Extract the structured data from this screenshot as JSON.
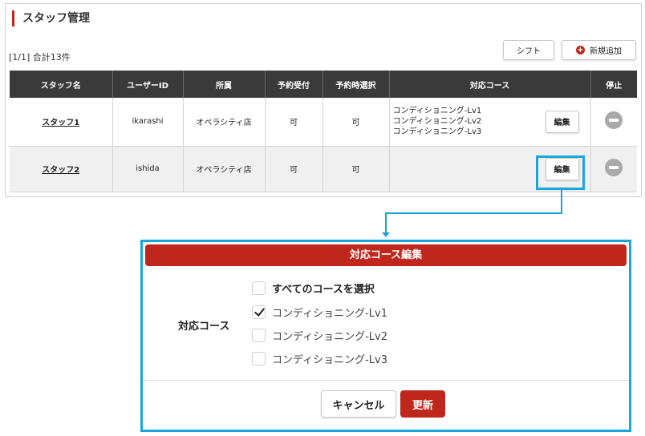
{
  "page": {
    "title": "スタッフ管理",
    "count": "[1/1] 合計13件",
    "shift_label": "シフト",
    "add_label": "新規追加"
  },
  "table": {
    "headers": [
      "スタッフ名",
      "ユーザーID",
      "所属",
      "予約受付",
      "予約時選択",
      "対応コース",
      "停止"
    ],
    "rows": [
      {
        "name": "スタッフ1",
        "user_id": "ikarashi",
        "store": "オペラシティ店",
        "reception": "可",
        "selectable": "可",
        "courses": [
          "コンディショニング-Lv1",
          "コンディショニング-Lv2",
          "コンディショニング-Lv3"
        ],
        "edit_label": "編集"
      },
      {
        "name": "スタッフ2",
        "user_id": "ishida",
        "store": "オペラシティ店",
        "reception": "可",
        "selectable": "可",
        "courses": [],
        "edit_label": "編集"
      }
    ]
  },
  "modal": {
    "title": "対応コース編集",
    "field_label": "対応コース",
    "select_all_label": "すべてのコースを選択",
    "options": [
      {
        "label": "コンディショニング-Lv1",
        "checked": true
      },
      {
        "label": "コンディショニング-Lv2",
        "checked": false
      },
      {
        "label": "コンディショニング-Lv3",
        "checked": false
      }
    ],
    "cancel_label": "キャンセル",
    "update_label": "更新"
  },
  "colors": {
    "brand_red": "#c0271c",
    "highlight_blue": "#1aa6dd",
    "header_dark": "#3a3a3a"
  },
  "icons": {
    "add": "plus-circle-icon",
    "stop": "minus-circle-icon",
    "check": "checkmark-icon"
  }
}
